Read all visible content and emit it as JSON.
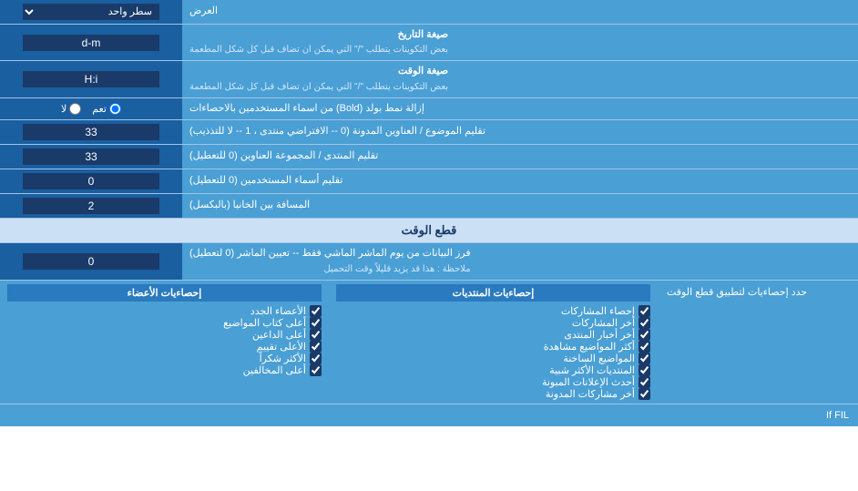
{
  "page": {
    "title": "العرض",
    "section_time_header": "قطع الوقت",
    "rows": [
      {
        "id": "display_mode",
        "label": "العرض",
        "input_type": "select",
        "options": [
          "سطر واحد"
        ],
        "selected": "سطر واحد"
      },
      {
        "id": "date_format",
        "label_main": "صيغة التاريخ",
        "label_sub": "بعض التكوينات يتطلب \"/\" التي يمكن ان تضاف قبل كل شكل المطعمة",
        "input_type": "text",
        "value": "d-m"
      },
      {
        "id": "time_format",
        "label_main": "صيغة الوقت",
        "label_sub": "بعض التكوينات يتطلب \"/\" التي يمكن ان تضاف قبل كل شكل المطعمة",
        "input_type": "text",
        "value": "H:i"
      },
      {
        "id": "bold_remove",
        "label": "إزالة نمط بولد (Bold) من اسماء المستخدمين بالاحصاءات",
        "input_type": "radio",
        "options": [
          "تعم",
          "لا"
        ],
        "selected": "تعم"
      },
      {
        "id": "topic_titles",
        "label": "تقليم الموضوع / العناوين المدونة (0 -- الافتراضي منتدى ، 1 -- لا للتذذيب)",
        "input_type": "text",
        "value": "33"
      },
      {
        "id": "forum_titles",
        "label": "تقليم المنتدى / المجموعة العناوين (0 للتعطيل)",
        "input_type": "text",
        "value": "33"
      },
      {
        "id": "usernames",
        "label": "تقليم أسماء المستخدمين (0 للتعطيل)",
        "input_type": "text",
        "value": "0"
      },
      {
        "id": "spacing",
        "label": "المسافة بين الخانيا (بالبكسل)",
        "input_type": "text",
        "value": "2"
      }
    ],
    "time_cut_row": {
      "label_main": "فرز البيانات من يوم الماشر الماشي فقط -- تعيين الماشر (0 لتعطيل)",
      "label_note": "ملاحظة : هذا قد يزيد قليلاً وقت التحميل",
      "value": "0"
    },
    "time_cut_limit_label": "حدد إحصاءيات لتطبيق قطع الوقت",
    "checkbox_cols": [
      {
        "id": "col_empty",
        "header": "",
        "items": []
      },
      {
        "id": "col_posts",
        "header": "إحصاءيات المنتديات",
        "items": [
          "إحصاء المشاركات",
          "أخر المشاركات",
          "أخر أخبار المنتدى",
          "أكثر المواضيع مشاهدة",
          "المواضيع الساخنة",
          "المنتديات الأكثر شبية",
          "أحدث الإعلانات المبونة",
          "أخر مشاركات المدونة"
        ]
      },
      {
        "id": "col_members",
        "header": "إحصاءيات الأعضاء",
        "items": [
          "الأعضاء الجدد",
          "أعلى كتاب المواضيع",
          "أعلى الداعين",
          "الأعلى تقييم",
          "الأكثر شكراً",
          "أعلى المخالفين"
        ]
      }
    ]
  }
}
